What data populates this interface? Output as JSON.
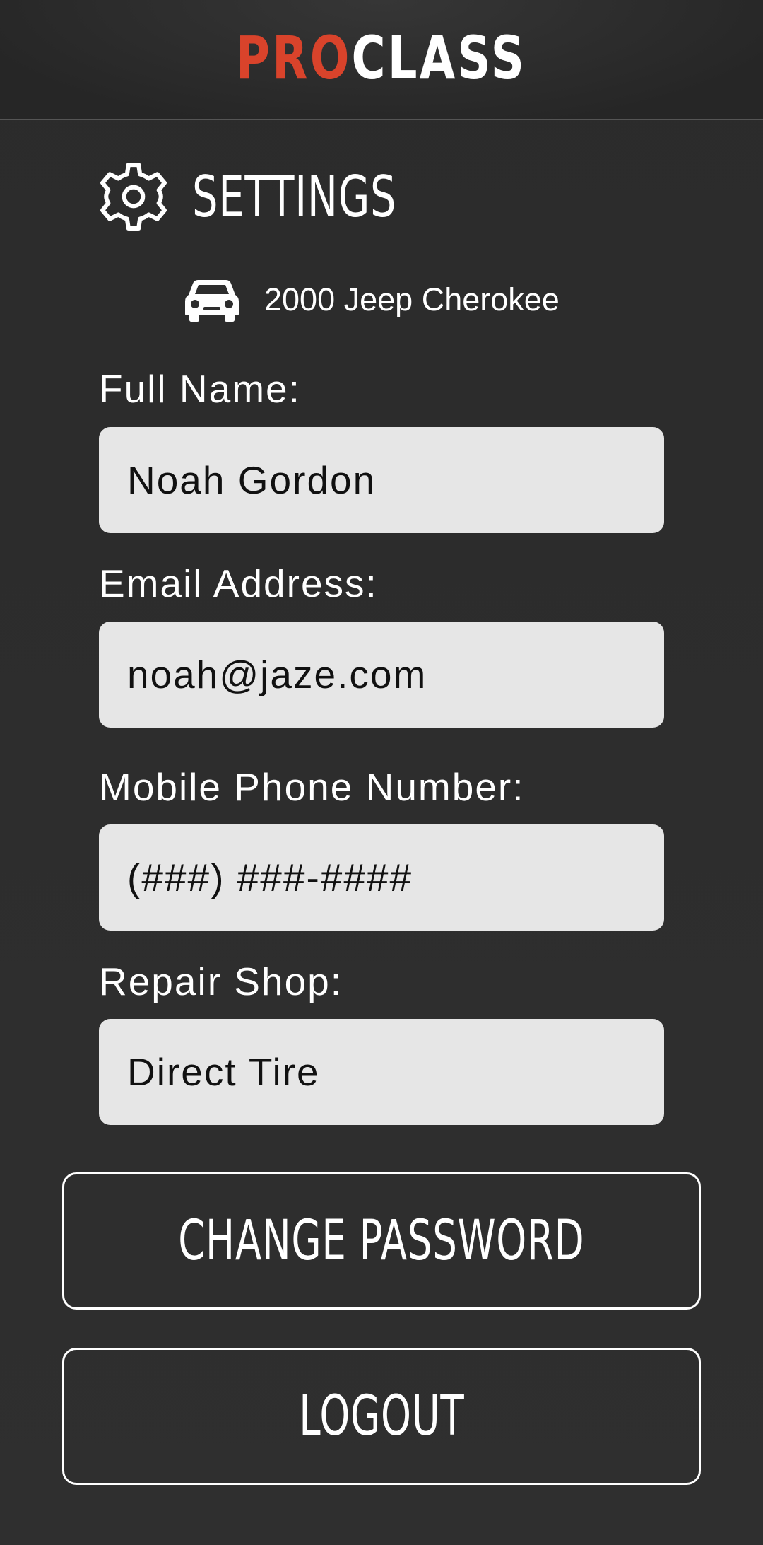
{
  "header": {
    "logo_part1": "PRO",
    "logo_part2": "CLASS",
    "logo_accent_color": "#d9432b"
  },
  "settings": {
    "icon": "gear-icon",
    "title": "SETTINGS"
  },
  "vehicle": {
    "icon": "car-icon",
    "name": "2000 Jeep Cherokee"
  },
  "form": {
    "full_name": {
      "label": "Full Name:",
      "value": "Noah Gordon"
    },
    "email": {
      "label": "Email Address:",
      "value": "noah@jaze.com"
    },
    "phone": {
      "label": "Mobile Phone Number:",
      "value": "(###) ###-####"
    },
    "repair_shop": {
      "label": "Repair Shop:",
      "value": "Direct Tire"
    }
  },
  "buttons": {
    "change_password": "CHANGE PASSWORD",
    "logout": "LOGOUT"
  }
}
